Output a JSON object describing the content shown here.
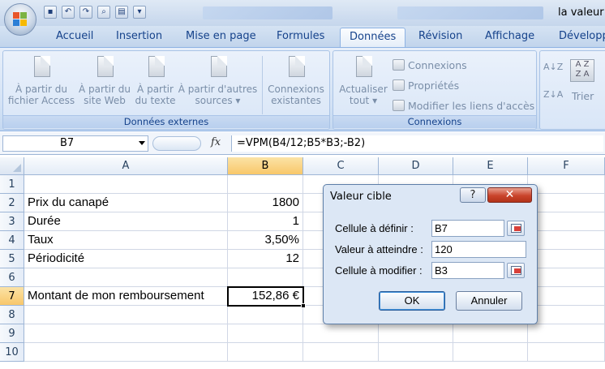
{
  "window": {
    "title": "la valeur"
  },
  "ribbon": {
    "tabs": [
      {
        "label": "Accueil"
      },
      {
        "label": "Insertion"
      },
      {
        "label": "Mise en page"
      },
      {
        "label": "Formules"
      },
      {
        "label": "Données"
      },
      {
        "label": "Révision"
      },
      {
        "label": "Affichage"
      },
      {
        "label": "Développ"
      }
    ],
    "active_tab": "Données",
    "external_data": {
      "group_label": "Données externes",
      "buttons": [
        {
          "line1": "À partir du",
          "line2": "fichier Access"
        },
        {
          "line1": "À partir du",
          "line2": "site Web"
        },
        {
          "line1": "À partir",
          "line2": "du texte"
        },
        {
          "line1": "À partir d'autres",
          "line2": "sources ▾"
        },
        {
          "line1": "Connexions",
          "line2": "existantes"
        }
      ]
    },
    "connections": {
      "group_label": "Connexions",
      "refresh": {
        "line1": "Actualiser",
        "line2": "tout ▾"
      },
      "small": [
        {
          "label": "Connexions"
        },
        {
          "label": "Propriétés"
        },
        {
          "label": "Modifier les liens d'accès"
        }
      ]
    },
    "sort": {
      "label": "Trier",
      "az": "A↓Z",
      "za": "Z↓A",
      "grid": "A Z\nZ A"
    }
  },
  "formula_bar": {
    "name_box": "B7",
    "fx": "fx",
    "formula": "=VPM(B4/12;B5*B3;-B2)"
  },
  "sheet": {
    "columns": [
      "A",
      "B",
      "C",
      "D",
      "E",
      "F"
    ],
    "rows": [
      "1",
      "2",
      "3",
      "4",
      "5",
      "6",
      "7",
      "8",
      "9",
      "10"
    ],
    "cells": {
      "A2": "Prix du canapé",
      "B2": "1800",
      "A3": "Durée",
      "B3": "1",
      "A4": "Taux",
      "B4": "3,50%",
      "A5": "Périodicité",
      "B5": "12",
      "A7": "Montant de mon remboursement",
      "B7": "152,86 €"
    },
    "active_cell": "B7"
  },
  "dialog": {
    "title": "Valeur cible",
    "help": "?",
    "close": "✕",
    "fields": [
      {
        "label": "Cellule à définir :",
        "value": "B7"
      },
      {
        "label": "Valeur à atteindre :",
        "value": "120"
      },
      {
        "label": "Cellule à modifier :",
        "value": "B3"
      }
    ],
    "ok": "OK",
    "cancel": "Annuler"
  },
  "colors": {
    "ribbon_text": "#15428b",
    "selected_header": "#f8c76a",
    "close_button": "#c9442c"
  }
}
